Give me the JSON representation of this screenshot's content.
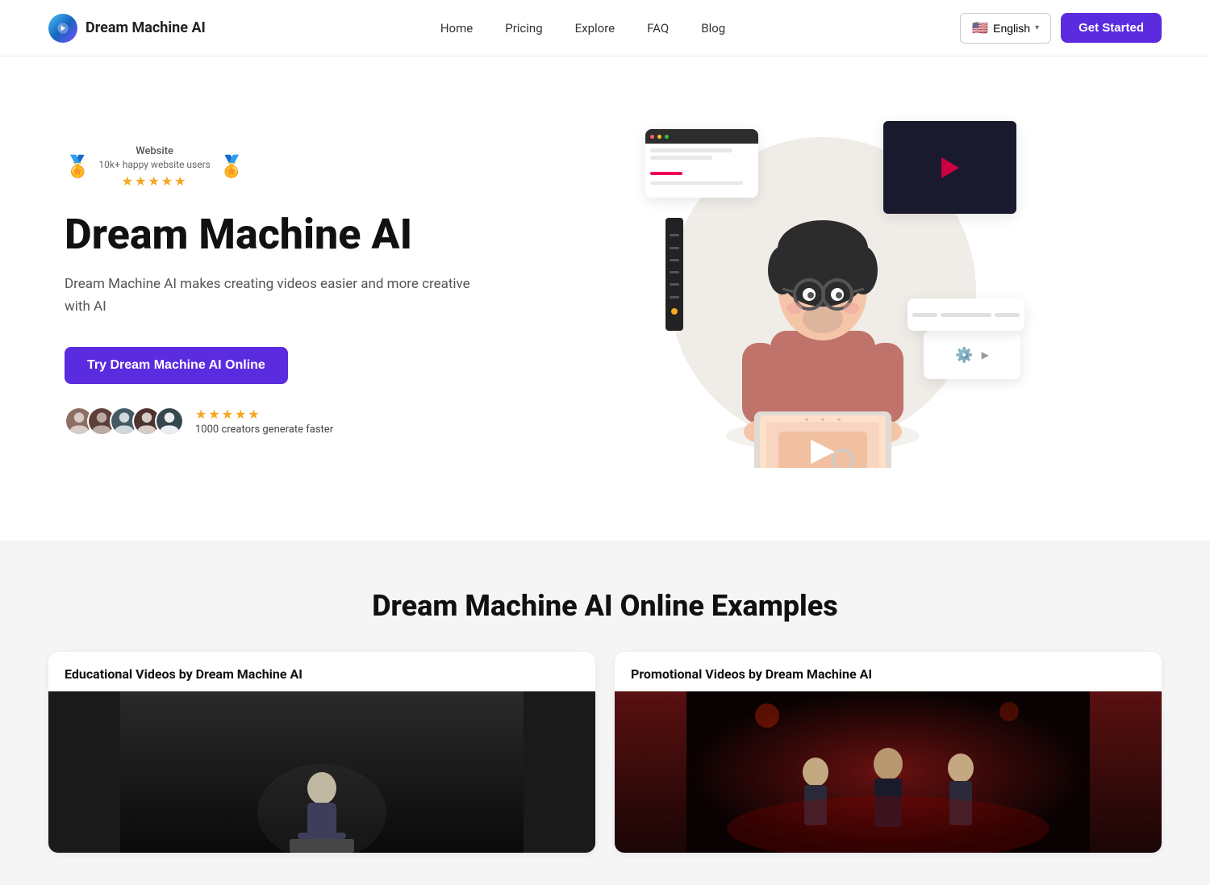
{
  "nav": {
    "logo_text": "Dream Machine AI",
    "links": [
      {
        "label": "Home",
        "id": "home"
      },
      {
        "label": "Pricing",
        "id": "pricing"
      },
      {
        "label": "Explore",
        "id": "explore"
      },
      {
        "label": "FAQ",
        "id": "faq"
      },
      {
        "label": "Blog",
        "id": "blog"
      }
    ],
    "lang_label": "English",
    "lang_flag": "🇺🇸",
    "get_started": "Get Started"
  },
  "hero": {
    "badge_title": "Website",
    "badge_sub": "10k+ happy website users",
    "badge_stars": "★★★★★",
    "title": "Dream Machine AI",
    "description": "Dream Machine AI makes creating videos easier and more creative with AI",
    "cta_label": "Try Dream Machine AI Online",
    "social_stars": "★★★★★",
    "social_desc": "1000 creators generate faster"
  },
  "examples": {
    "section_title": "Dream Machine AI Online Examples",
    "cards": [
      {
        "title": "Educational Videos by Dream Machine AI",
        "thumb_style": "dark"
      },
      {
        "title": "Promotional Videos by Dream Machine AI",
        "thumb_style": "red"
      }
    ]
  }
}
